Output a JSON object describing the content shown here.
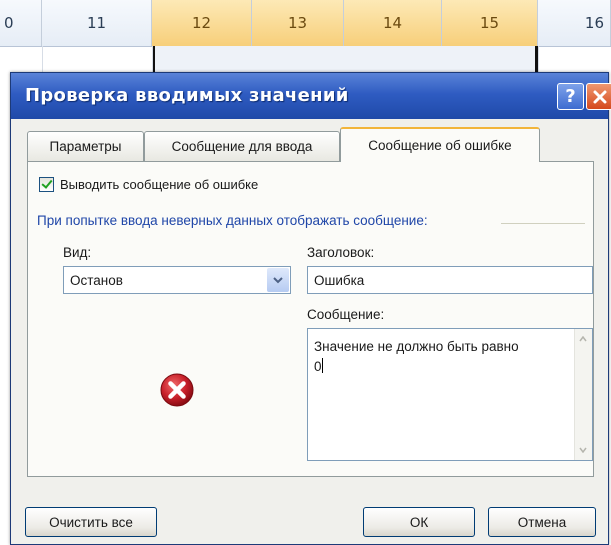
{
  "spreadsheet": {
    "columns": [
      "0",
      "11",
      "12",
      "13",
      "14",
      "15",
      "16"
    ]
  },
  "dialog": {
    "title": "Проверка вводимых значений",
    "help_icon": "help-icon",
    "close_icon": "close-icon",
    "tabs": [
      {
        "label": "Параметры",
        "active": false
      },
      {
        "label": "Сообщение для ввода",
        "active": false
      },
      {
        "label": "Сообщение об ошибке",
        "active": true
      }
    ],
    "show_error_checkbox": {
      "label": "Выводить сообщение об ошибке",
      "checked": true
    },
    "group_label": "При попытке ввода неверных данных отображать сообщение:",
    "style_label": "Вид:",
    "style_value": "Останов",
    "title_label": "Заголовок:",
    "title_value": "Ошибка",
    "message_label": "Сообщение:",
    "message_lines": [
      "Значение не должно быть равно",
      "0"
    ],
    "error_icon": "stop-error-icon",
    "buttons": {
      "clear_all": "Очистить все",
      "ok": "ОК",
      "cancel": "Отмена"
    },
    "colors": {
      "titlebar": "#2f5cc2",
      "group_label": "#1f46a8",
      "active_tab_accent": "#f2b53a",
      "error_icon": "#c8202a"
    }
  }
}
